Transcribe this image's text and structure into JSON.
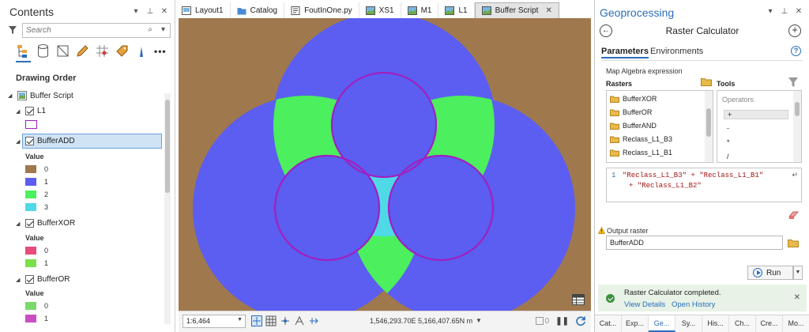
{
  "contents": {
    "title": "Contents",
    "search_placeholder": "Search",
    "drawing_order": "Drawing Order",
    "map_name": "Buffer Script",
    "layers": {
      "l1": "L1",
      "bufferadd": {
        "name": "BufferADD",
        "legend_title": "Value",
        "classes": [
          {
            "label": "0",
            "color": "#a0784e"
          },
          {
            "label": "1",
            "color": "#5b5ef0"
          },
          {
            "label": "2",
            "color": "#4cef5d"
          },
          {
            "label": "3",
            "color": "#4fd9e6"
          }
        ]
      },
      "bufferxor": {
        "name": "BufferXOR",
        "legend_title": "Value",
        "classes": [
          {
            "label": "0",
            "color": "#e64b7c"
          },
          {
            "label": "1",
            "color": "#7be04a"
          }
        ]
      },
      "bufferor": {
        "name": "BufferOR",
        "legend_title": "Value",
        "classes": [
          {
            "label": "0",
            "color": "#79d96a"
          },
          {
            "label": "1",
            "color": "#c84fc2"
          }
        ]
      }
    }
  },
  "tabs": [
    {
      "label": "Layout1"
    },
    {
      "label": "Catalog"
    },
    {
      "label": "FoutInOne.py"
    },
    {
      "label": "XS1"
    },
    {
      "label": "M1"
    },
    {
      "label": "L1"
    },
    {
      "label": "Buffer Script"
    }
  ],
  "statusbar": {
    "scale": "1:6,464",
    "coordinates": "1,546,293.70E 5,166,407.65N m",
    "selected_count": "0"
  },
  "geoprocessing": {
    "title": "Geoprocessing",
    "tool_name": "Raster Calculator",
    "tab_parameters": "Parameters",
    "tab_environments": "Environments",
    "map_algebra_label": "Map Algebra expression",
    "rasters_label": "Rasters",
    "tools_label": "Tools",
    "rasters": [
      "BufferXOR",
      "BufferOR",
      "BufferAND",
      "Reclass_L1_B3",
      "Reclass_L1_B1"
    ],
    "operators_header": "Operators",
    "operators": [
      "+",
      "-",
      "*",
      "/"
    ],
    "expression_line_number": "1",
    "expression_line1": "\"Reclass_L1_B3\" + \"Reclass_L1_B1\"",
    "expression_line2": "+ \"Reclass_L1_B2\"",
    "output_label": "Output raster",
    "output_value": "BufferADD",
    "run_label": "Run",
    "message": "Raster Calculator completed.",
    "view_details": "View Details",
    "open_history": "Open History"
  },
  "bottom_tabs": [
    "Cat...",
    "Exp...",
    "Ge...",
    "Sy...",
    "His...",
    "Ch...",
    "Cre...",
    "Mo..."
  ],
  "map_colors": {
    "background": "#a0784e",
    "value1": "#5b5ef0",
    "value2": "#4cef5d",
    "value3": "#4fd9e6",
    "outline": "#a020c0"
  }
}
